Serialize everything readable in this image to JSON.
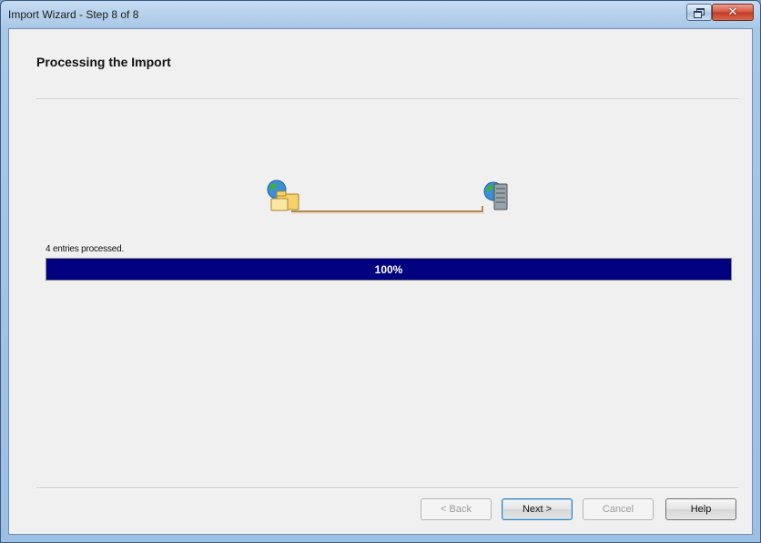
{
  "window": {
    "title": "Import Wizard - Step 8 of 8"
  },
  "page": {
    "heading": "Processing the Import"
  },
  "animation": {
    "source_icon": "globe-folder-icon",
    "target_icon": "globe-server-icon"
  },
  "status": {
    "message": "4 entries processed.",
    "progress_label": "100%",
    "progress_fraction": 1.0
  },
  "buttons": {
    "back": {
      "label": "< Back",
      "enabled": false
    },
    "next": {
      "label": "Next >",
      "enabled": true
    },
    "cancel": {
      "label": "Cancel",
      "enabled": false
    },
    "help": {
      "label": "Help",
      "enabled": true
    }
  },
  "colors": {
    "progress_fill": "#000080",
    "dialog_background": "#f0f0f0",
    "close_button": "#c23a23"
  }
}
